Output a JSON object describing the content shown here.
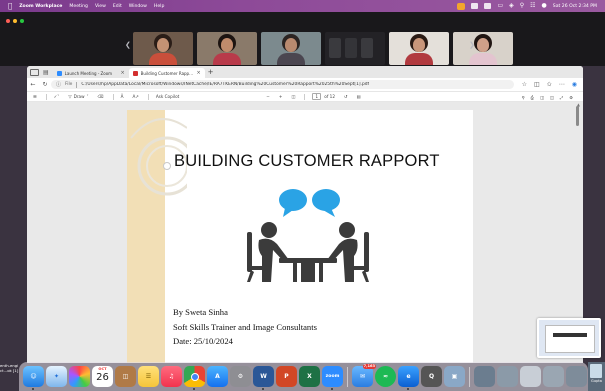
{
  "menubar": {
    "app_name": "Zoom Workplace",
    "menus": [
      "Meeting",
      "View",
      "Edit",
      "Window",
      "Help"
    ],
    "datetime": "Sat 26 Oct  2:34 PM"
  },
  "zoom": {
    "participant_count": 5
  },
  "browser": {
    "tabs": [
      {
        "title": "Launch Meeting - Zoom",
        "active": false
      },
      {
        "title": "Building Customer Rapport 25th Sept[1].pdf",
        "active": true
      }
    ],
    "address": {
      "prefix": "File",
      "url": "C:/Users/hp/AppData/Local/Microsoft/Windows/INetCache/IE/RA7TKERN/Building%20Customer%20Rapport%2025th%20Sept[1].pdf"
    },
    "pdf_toolbar": {
      "draw_label": "Draw",
      "ask_copilot_label": "Ask Copilot",
      "zoom_minus": "−",
      "zoom_plus": "+",
      "page_current": "1",
      "page_total": "of 12"
    }
  },
  "document": {
    "title": "BUILDING CUSTOMER RAPPORT",
    "author": "By Sweta Sinha",
    "role": "Soft Skills Trainer and Image Consultants",
    "date": "Date: 25/10/2024"
  },
  "dock": {
    "calendar_month": "OCT",
    "calendar_day": "26",
    "mail_badge": "7,163",
    "zoom_label": "zoom"
  },
  "side": {
    "left_lines": [
      "enth-engi",
      "ct...ok [1]"
    ],
    "right_label": "Gupta"
  },
  "colors": {
    "menubar": "#8d4a98",
    "pdf_accent": "#d32f2f",
    "speech_bubble": "#2aa3e5",
    "figure": "#3b3b3b",
    "deco_strip": "#f2dfb6"
  }
}
